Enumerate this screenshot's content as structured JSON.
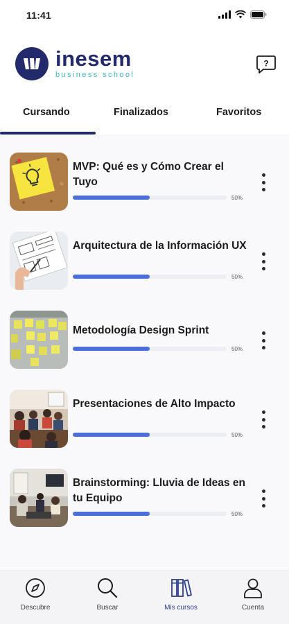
{
  "status_bar": {
    "time": "11:41"
  },
  "brand": {
    "name": "inesem",
    "tagline": "business school",
    "primary_color": "#232a6b",
    "accent_color": "#36b6c4"
  },
  "header": {
    "help_icon": "help-chat-icon"
  },
  "tabs": [
    {
      "label": "Cursando",
      "active": true
    },
    {
      "label": "Finalizados",
      "active": false
    },
    {
      "label": "Favoritos",
      "active": false
    }
  ],
  "courses": [
    {
      "title": "MVP: Qué es y Cómo Crear el Tuyo",
      "progress": 50,
      "progress_label": "50%",
      "thumbnail": "sticky-note-lightbulb"
    },
    {
      "title": "Arquitectura de la Información UX",
      "progress": 50,
      "progress_label": "50%",
      "thumbnail": "hand-drawn-wireframes"
    },
    {
      "title": "Metodología Design Sprint",
      "progress": 50,
      "progress_label": "50%",
      "thumbnail": "sticky-notes-wall"
    },
    {
      "title": "Presentaciones de Alto Impacto",
      "progress": 50,
      "progress_label": "50%",
      "thumbnail": "audience-presentation"
    },
    {
      "title": "Brainstorming: Lluvia de Ideas en tu Equipo",
      "progress": 50,
      "progress_label": "50%",
      "thumbnail": "team-meeting-room"
    }
  ],
  "progress_color": "#4a6fd8",
  "bottom_nav": [
    {
      "label": "Descubre",
      "icon": "compass-icon"
    },
    {
      "label": "Buscar",
      "icon": "search-icon"
    },
    {
      "label": "Mis cursos",
      "icon": "books-icon",
      "active": true
    },
    {
      "label": "Cuenta",
      "icon": "user-icon"
    }
  ]
}
